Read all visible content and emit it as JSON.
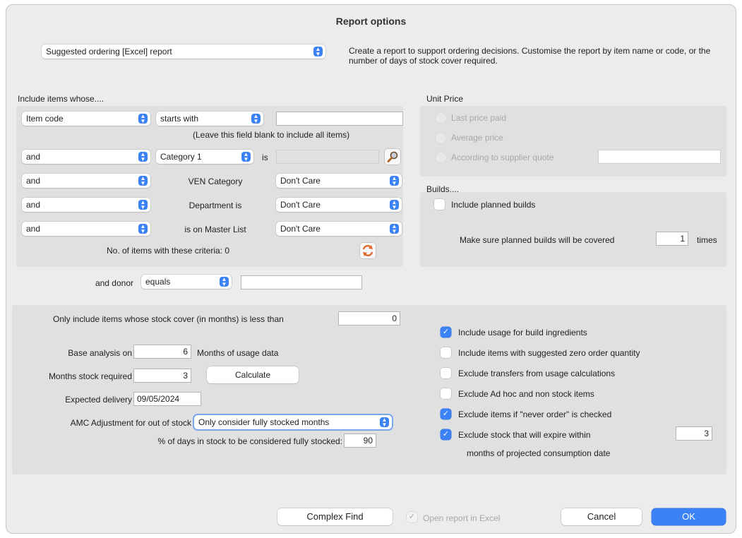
{
  "dialog": {
    "title": "Report options"
  },
  "report_type": {
    "selected": "Suggested ordering [Excel] report",
    "description": "Create a report to support ordering decisions.  Customise the report by item name or code, or the number of days of stock cover required."
  },
  "include_items": {
    "heading": "Include items whose....",
    "row1": {
      "field": "Item code",
      "operator": "starts with",
      "value": ""
    },
    "blank_hint": "(Leave this field blank to include all items)",
    "row2": {
      "conj": "and",
      "field": "Category 1",
      "is_label": "is",
      "value": ""
    },
    "row3": {
      "conj": "and",
      "label": "VEN Category",
      "value": "Don't Care"
    },
    "row4": {
      "conj": "and",
      "label": "Department is",
      "value": "Don't Care"
    },
    "row5": {
      "conj": "and",
      "label": "is on Master List",
      "value": "Don't Care"
    },
    "count_label": "No. of items with these criteria:",
    "count_value": "0",
    "lookup_icon": "magnifier-icon",
    "refresh_icon": "refresh-icon"
  },
  "donor": {
    "label": "and donor",
    "operator": "equals",
    "value": ""
  },
  "unit_price": {
    "heading": "Unit Price",
    "options": [
      "Last price paid",
      "Average price",
      "According to supplier quote"
    ],
    "quote_value": ""
  },
  "builds": {
    "heading": "Builds....",
    "include_planned_label": "Include planned builds",
    "include_planned_checked": false,
    "covered_label": "Make sure planned builds will be covered",
    "covered_value": "1",
    "covered_suffix": "times"
  },
  "analysis": {
    "stock_cover_label": "Only include items whose stock cover (in months) is less than",
    "stock_cover_value": "0",
    "base_label": "Base analysis on",
    "base_value": "6",
    "base_suffix": "Months of usage data",
    "months_required_label": "Months stock required",
    "months_required_value": "3",
    "calculate_label": "Calculate",
    "expected_label": "Expected delivery",
    "expected_value": "09/05/2024",
    "amc_label": "AMC Adjustment for out of stock",
    "amc_value": "Only consider fully stocked months",
    "pct_label": "% of days in stock to be considered fully stocked:",
    "pct_value": "90"
  },
  "options": {
    "usage_build": {
      "label": "Include usage for build ingredients",
      "checked": true
    },
    "zero_order": {
      "label": "Include items with suggested zero order quantity",
      "checked": false
    },
    "exclude_transfers": {
      "label": "Exclude transfers from usage calculations",
      "checked": false
    },
    "exclude_adhoc": {
      "label": "Exclude Ad hoc and non stock items",
      "checked": false
    },
    "exclude_never": {
      "label": "Exclude items if \"never order\" is checked",
      "checked": true
    },
    "exclude_expire": {
      "label": "Exclude stock that will expire within",
      "checked": true,
      "value": "3"
    },
    "expire_suffix": "months of projected consumption date"
  },
  "footer": {
    "complex_find": "Complex Find",
    "open_excel": "Open report in Excel",
    "cancel": "Cancel",
    "ok": "OK"
  },
  "colors": {
    "accent": "#3b82f6",
    "panel": "#e0e0e0",
    "window": "#ececec"
  }
}
